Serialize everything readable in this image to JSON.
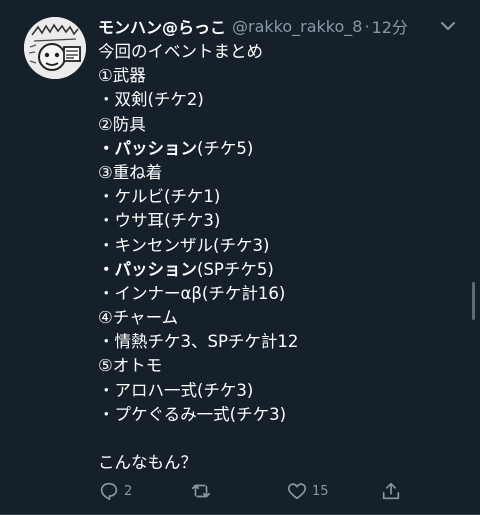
{
  "tweet": {
    "display_name": "モンハン@らっこ",
    "handle": "@rakko_rakko_8",
    "separator": "·",
    "time": "12分",
    "lines": [
      {
        "text": "今回のイベントまとめ"
      },
      {
        "text": "①武器"
      },
      {
        "text": "・双剣(チケ2)"
      },
      {
        "text": "②防具"
      },
      {
        "text": "パッション",
        "prefix": "・",
        "suffix": "(チケ5)"
      },
      {
        "text": "③重ね着"
      },
      {
        "text": "・ケルビ(チケ1)"
      },
      {
        "text": "・ウサ耳(チケ3)"
      },
      {
        "text": "・キンセンザル(チケ3)"
      },
      {
        "text": "パッション",
        "prefix": "・",
        "suffix": "(SPチケ5)"
      },
      {
        "text": "・インナーαβ(チケ計16)"
      },
      {
        "text": "④チャーム"
      },
      {
        "text": "・情熱チケ3、SPチケ計12"
      },
      {
        "text": "⑤オトモ"
      },
      {
        "text": "・アロハ一式(チケ3)"
      },
      {
        "text": "・プケぐるみ一式(チケ3)"
      },
      {
        "text": ""
      },
      {
        "text": "こんなもん？"
      }
    ],
    "actions": {
      "reply_count": "2",
      "retweet_count": "",
      "like_count": "15"
    },
    "icons": {
      "avatar": "avatar-icon",
      "caret": "chevron-down-icon",
      "reply": "reply-icon",
      "retweet": "retweet-icon",
      "like": "heart-icon",
      "share": "share-icon"
    },
    "colors": {
      "background": "#15202b",
      "text": "#ffffff",
      "secondary": "#8899a6"
    }
  }
}
